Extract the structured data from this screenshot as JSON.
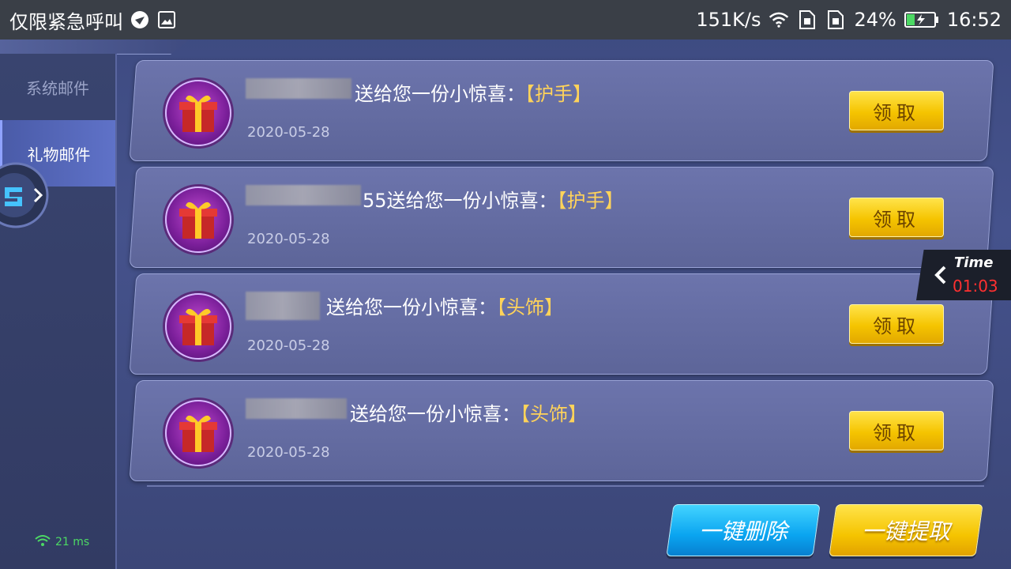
{
  "status_bar": {
    "emergency_text": "仅限紧急呼叫",
    "net_speed": "151K/s",
    "battery_percent": "24%",
    "time": "16:52"
  },
  "sidebar": {
    "tabs": [
      {
        "label": "系统邮件",
        "active": false
      },
      {
        "label": "礼物邮件",
        "active": true
      }
    ],
    "ping": "21 ms"
  },
  "mails": [
    {
      "sender_suffix": "",
      "text": "送给您一份小惊喜：",
      "item": "【护手】",
      "date": "2020-05-28",
      "claim_label": "领取"
    },
    {
      "sender_suffix": "55",
      "text": "送给您一份小惊喜：",
      "item": "【护手】",
      "date": "2020-05-28",
      "claim_label": "领取"
    },
    {
      "sender_suffix": "",
      "text": "送给您一份小惊喜：",
      "item": "【头饰】",
      "date": "2020-05-28",
      "claim_label": "领取"
    },
    {
      "sender_suffix": "",
      "text": "送给您一份小惊喜：",
      "item": "【头饰】",
      "date": "2020-05-28",
      "claim_label": "领取"
    }
  ],
  "timer": {
    "label": "Time",
    "value": "01:03"
  },
  "actions": {
    "delete_all": "一键删除",
    "claim_all": "一键提取"
  },
  "colors": {
    "claim_yellow": "#f5c400",
    "item_gold": "#ffd35a",
    "delete_blue": "#0aa4f0",
    "timer_red": "#ff3030"
  }
}
